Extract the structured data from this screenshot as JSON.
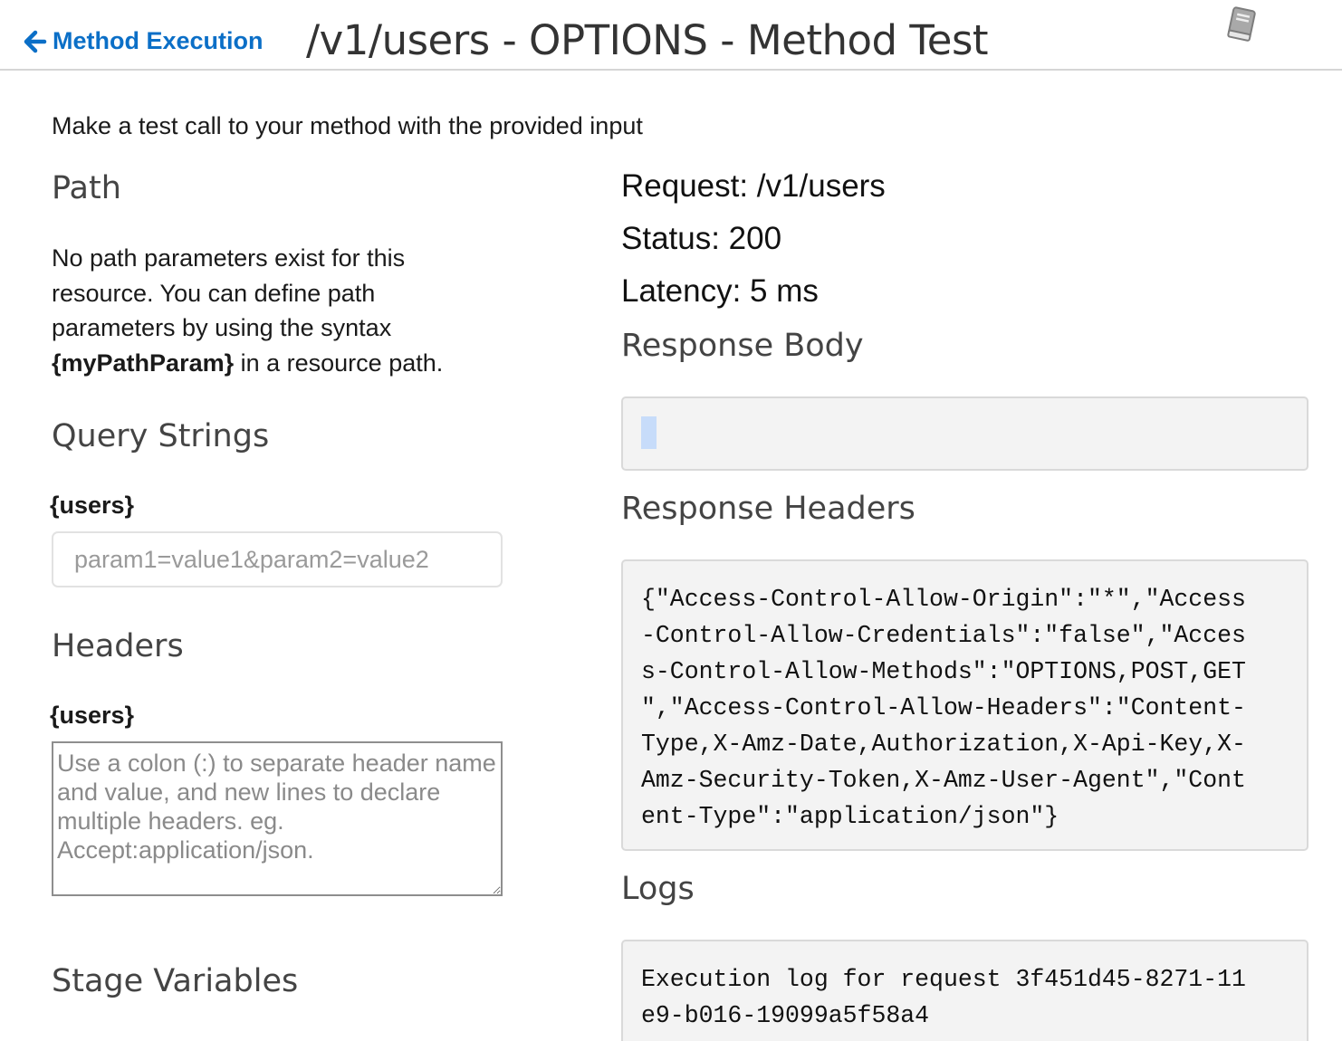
{
  "header": {
    "back_label": "Method Execution",
    "title": "/v1/users - OPTIONS - Method Test",
    "icons": {
      "back": "arrow-left-icon",
      "docs": "book-icon"
    },
    "accent_color": "#0b6fc7"
  },
  "intro": "Make a test call to your method with the provided input",
  "left": {
    "path": {
      "heading": "Path",
      "desc_lines": [
        "No path parameters exist for this",
        "resource. You can define path",
        "parameters by using the syntax"
      ],
      "desc_bold": "{myPathParam}",
      "desc_tail": " in a resource path."
    },
    "query": {
      "heading": "Query Strings",
      "label": "{users}",
      "placeholder": "param1=value1&param2=value2"
    },
    "headers": {
      "heading": "Headers",
      "label": "{users}",
      "placeholder": "Use a colon (:) to separate header name and value, and new lines to declare multiple headers. eg. Accept:application/json."
    },
    "stage": {
      "heading": "Stage Variables"
    }
  },
  "right": {
    "request": "Request: /v1/users",
    "status": "Status: 200",
    "latency": "Latency: 5 ms",
    "response_body": {
      "heading": "Response Body",
      "value": ""
    },
    "response_headers": {
      "heading": "Response Headers",
      "lines": [
        "{\"Access-Control-Allow-Origin\":\"*\",\"Access",
        "-Control-Allow-Credentials\":\"false\",\"Acces",
        "s-Control-Allow-Methods\":\"OPTIONS,POST,GET",
        "\",\"Access-Control-Allow-Headers\":\"Content-",
        "Type,X-Amz-Date,Authorization,X-Api-Key,X-",
        "Amz-Security-Token,X-Amz-User-Agent\",\"Cont",
        "ent-Type\":\"application/json\"}"
      ]
    },
    "logs": {
      "heading": "Logs",
      "lines": [
        "Execution log for request 3f451d45-8271-11",
        "e9-b016-19099a5f58a4"
      ]
    }
  }
}
